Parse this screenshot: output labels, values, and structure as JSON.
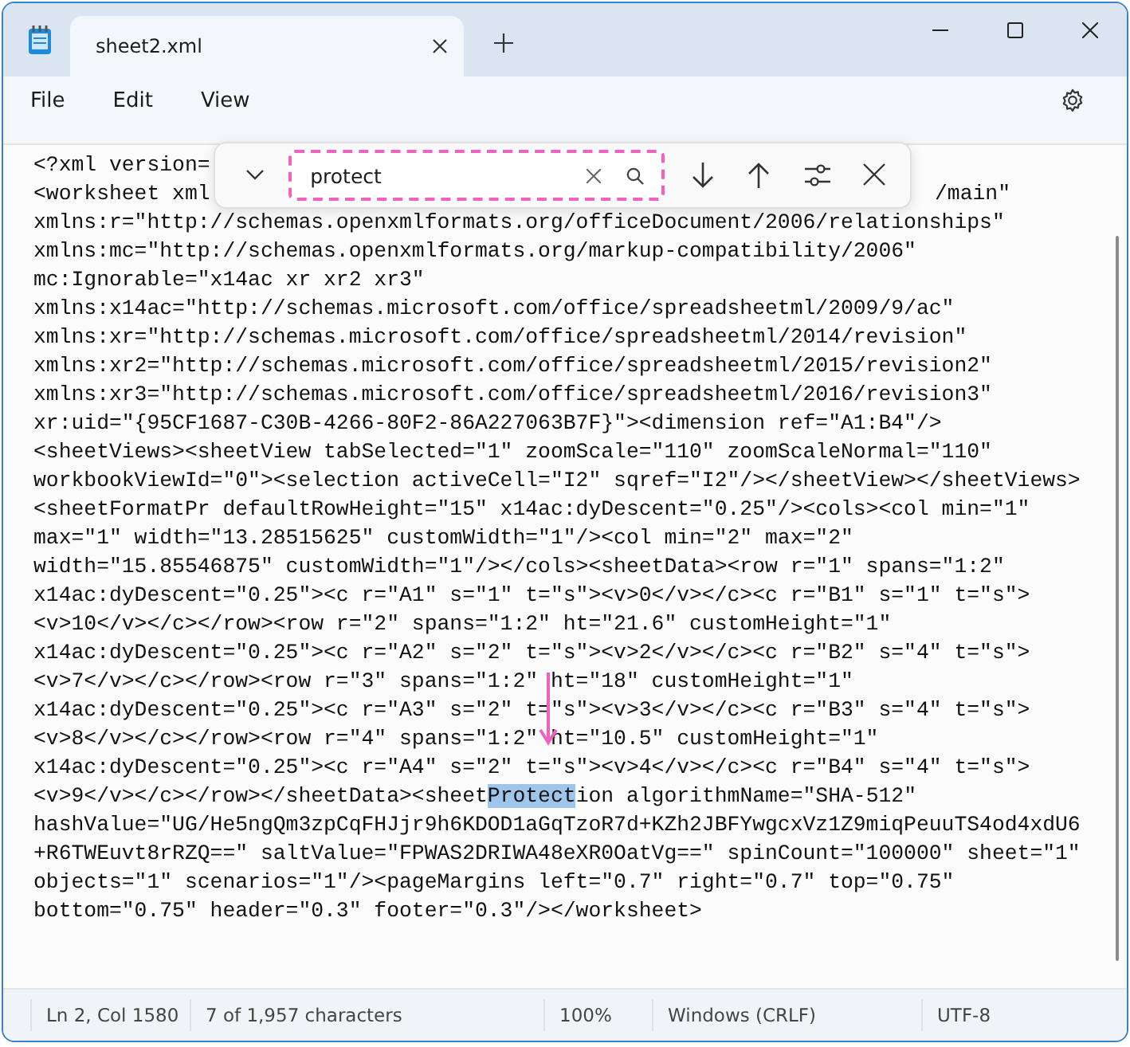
{
  "tabs": [
    {
      "title": "sheet2.xml",
      "selected": true
    }
  ],
  "menu": [
    "File",
    "Edit",
    "View"
  ],
  "find": {
    "query": "protect",
    "outlined": true
  },
  "editor": {
    "lines": [
      {
        "kind": "split",
        "left": "<?xml version="
      },
      {
        "kind": "split",
        "left": "<worksheet xml",
        "right": "/main\""
      },
      {
        "kind": "plain",
        "text": "xmlns:r=\"http://schemas.openxmlformats.org/officeDocument/2006/relationships\""
      },
      {
        "kind": "plain",
        "text": "xmlns:mc=\"http://schemas.openxmlformats.org/markup-compatibility/2006\""
      },
      {
        "kind": "plain",
        "text": "mc:Ignorable=\"x14ac xr xr2 xr3\""
      },
      {
        "kind": "plain",
        "text": "xmlns:x14ac=\"http://schemas.microsoft.com/office/spreadsheetml/2009/9/ac\""
      },
      {
        "kind": "plain",
        "text": "xmlns:xr=\"http://schemas.microsoft.com/office/spreadsheetml/2014/revision\""
      },
      {
        "kind": "plain",
        "text": "xmlns:xr2=\"http://schemas.microsoft.com/office/spreadsheetml/2015/revision2\""
      },
      {
        "kind": "plain",
        "text": "xmlns:xr3=\"http://schemas.microsoft.com/office/spreadsheetml/2016/revision3\""
      },
      {
        "kind": "plain",
        "text": "xr:uid=\"{95CF1687-C30B-4266-80F2-86A227063B7F}\"><dimension ref=\"A1:B4\"/>"
      },
      {
        "kind": "plain",
        "text": "<sheetViews><sheetView tabSelected=\"1\" zoomScale=\"110\" zoomScaleNormal=\"110\""
      },
      {
        "kind": "plain",
        "text": "workbookViewId=\"0\"><selection activeCell=\"I2\" sqref=\"I2\"/></sheetView></sheetViews>"
      },
      {
        "kind": "plain",
        "text": "<sheetFormatPr defaultRowHeight=\"15\" x14ac:dyDescent=\"0.25\"/><cols><col min=\"1\""
      },
      {
        "kind": "plain",
        "text": "max=\"1\" width=\"13.28515625\" customWidth=\"1\"/><col min=\"2\" max=\"2\""
      },
      {
        "kind": "plain",
        "text": "width=\"15.85546875\" customWidth=\"1\"/></cols><sheetData><row r=\"1\" spans=\"1:2\""
      },
      {
        "kind": "plain",
        "text": "x14ac:dyDescent=\"0.25\"><c r=\"A1\" s=\"1\" t=\"s\"><v>0</v></c><c r=\"B1\" s=\"1\" t=\"s\">"
      },
      {
        "kind": "plain",
        "text": "<v>10</v></c></row><row r=\"2\" spans=\"1:2\" ht=\"21.6\" customHeight=\"1\""
      },
      {
        "kind": "plain",
        "text": "x14ac:dyDescent=\"0.25\"><c r=\"A2\" s=\"2\" t=\"s\"><v>2</v></c><c r=\"B2\" s=\"4\" t=\"s\">"
      },
      {
        "kind": "plain",
        "text": "<v>7</v></c></row><row r=\"3\" spans=\"1:2\" ht=\"18\" customHeight=\"1\""
      },
      {
        "kind": "plain",
        "text": "x14ac:dyDescent=\"0.25\"><c r=\"A3\" s=\"2\" t=\"s\"><v>3</v></c><c r=\"B3\" s=\"4\" t=\"s\">"
      },
      {
        "kind": "plain",
        "text": "<v>8</v></c></row><row r=\"4\" spans=\"1:2\" ht=\"10.5\" customHeight=\"1\""
      },
      {
        "kind": "plain",
        "text": "x14ac:dyDescent=\"0.25\"><c r=\"A4\" s=\"2\" t=\"s\"><v>4</v></c><c r=\"B4\" s=\"4\" t=\"s\">"
      },
      {
        "kind": "match",
        "before": "<v>9</v></c></row></sheetData><sheet",
        "match": "Protect",
        "after": "ion algorithmName=\"SHA-512\""
      },
      {
        "kind": "plain",
        "text": "hashValue=\"UG/He5ngQm3zpCqFHJjr9h6KDOD1aGqTzoR7d+KZh2JBFYwgcxVz1Z9miqPeuuTS4od4xdU6"
      },
      {
        "kind": "plain",
        "text": "+R6TWEuvt8rRZQ==\" saltValue=\"FPWAS2DRIWA48eXR0OatVg==\" spinCount=\"100000\" sheet=\"1\""
      },
      {
        "kind": "plain",
        "text": "objects=\"1\" scenarios=\"1\"/><pageMargins left=\"0.7\" right=\"0.7\" top=\"0.75\""
      },
      {
        "kind": "plain",
        "text": "bottom=\"0.75\" header=\"0.3\" footer=\"0.3\"/></worksheet>"
      }
    ],
    "arrow": true
  },
  "status_bar": [
    "Ln 2, Col 1580",
    "7 of 1,957 characters",
    "100%",
    "Windows (CRLF)",
    "UTF-8"
  ]
}
